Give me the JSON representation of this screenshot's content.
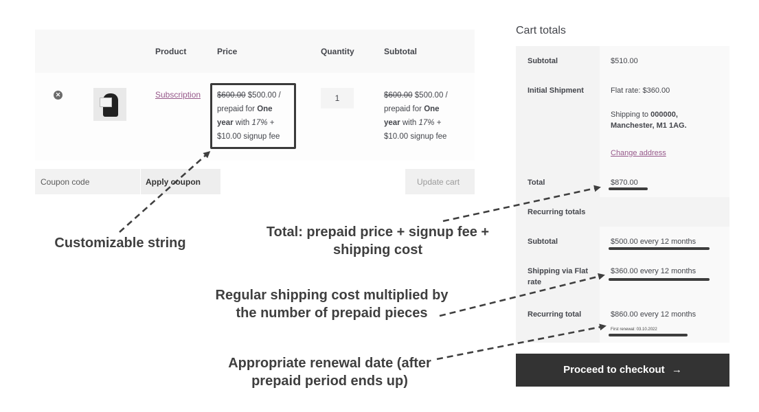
{
  "cart": {
    "headers": {
      "product": "Product",
      "price": "Price",
      "quantity": "Quantity",
      "subtotal": "Subtotal"
    },
    "item": {
      "remove_icon": "close-circle-icon",
      "product_name": "Subscription",
      "price": {
        "old": "$600.00",
        "new": "$500.00",
        "slash": " /",
        "prepaid_for": "prepaid for ",
        "one": "One",
        "year": "year",
        "with": " with ",
        "pct": "17%",
        "plus": " +",
        "fee": "$10.00",
        "signup": " signup fee"
      },
      "quantity": "1",
      "subtotal": {
        "old": "$600.00",
        "new": "$500.00",
        "slash": " /",
        "prepaid_for": "prepaid for ",
        "one": "One",
        "year": "year",
        "with": " with ",
        "pct": "17%",
        "plus": " +",
        "fee": "$10.00",
        "signup": " signup fee"
      }
    },
    "coupon_placeholder": "Coupon code",
    "apply_coupon": "Apply coupon",
    "update_cart": "Update cart"
  },
  "totals": {
    "title": "Cart totals",
    "subtotal_label": "Subtotal",
    "subtotal_value": "$510.00",
    "initial_shipment_label": "Initial Shipment",
    "flat_rate": "Flat rate: $360.00",
    "shipping_to_prefix": "Shipping to ",
    "shipping_to_bold1": "000000,",
    "shipping_to_bold2": "Manchester, M1 1AG.",
    "change_address": "Change address",
    "total_label": "Total",
    "total_value": "$870.00",
    "recurring_totals_label": "Recurring totals",
    "recurring_subtotal_label": "Subtotal",
    "recurring_subtotal_value": "$500.00 every 12 months",
    "shipping_flat_label": "Shipping via Flat rate",
    "shipping_flat_value": "$360.00 every 12 months",
    "recurring_total_label": "Recurring total",
    "recurring_total_value": "$860.00 every 12 months",
    "first_renewal": "First renewal: 03.10.2022"
  },
  "checkout": {
    "label": "Proceed to checkout",
    "arrow": "→"
  },
  "annotations": {
    "customizable": "Customizable string",
    "total_line1": "Total: prepaid price + signup fee +",
    "total_line2": "shipping cost",
    "shipping_line1": "Regular shipping cost multiplied by",
    "shipping_line2": "the number of prepaid pieces",
    "renewal_line1": "Appropriate renewal date (after",
    "renewal_line2": "prepaid period ends up)"
  }
}
